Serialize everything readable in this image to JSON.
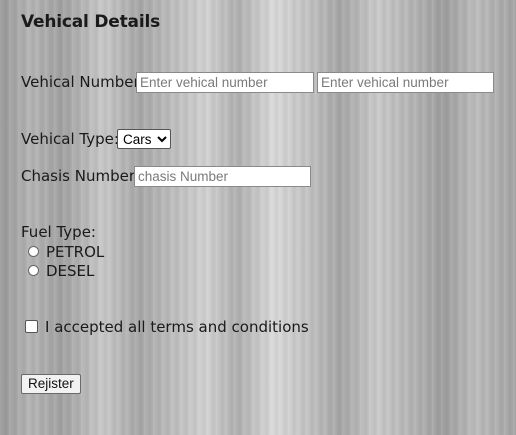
{
  "form": {
    "title": "Vehical Details",
    "vehicle_number": {
      "label": "Vehical Number",
      "placeholder_1": "Enter vehical number",
      "placeholder_2": "Enter vehical number"
    },
    "vehicle_type": {
      "label": "Vehical Type:",
      "selected": "Cars"
    },
    "chassis_number": {
      "label": "Chasis Number:",
      "placeholder": "chasis Number"
    },
    "fuel_type": {
      "label": "Fuel Type:",
      "options": [
        "PETROL",
        "DESEL"
      ]
    },
    "terms": {
      "label": "I accepted all terms and conditions",
      "checked": false
    },
    "submit_label": "Rejister"
  }
}
